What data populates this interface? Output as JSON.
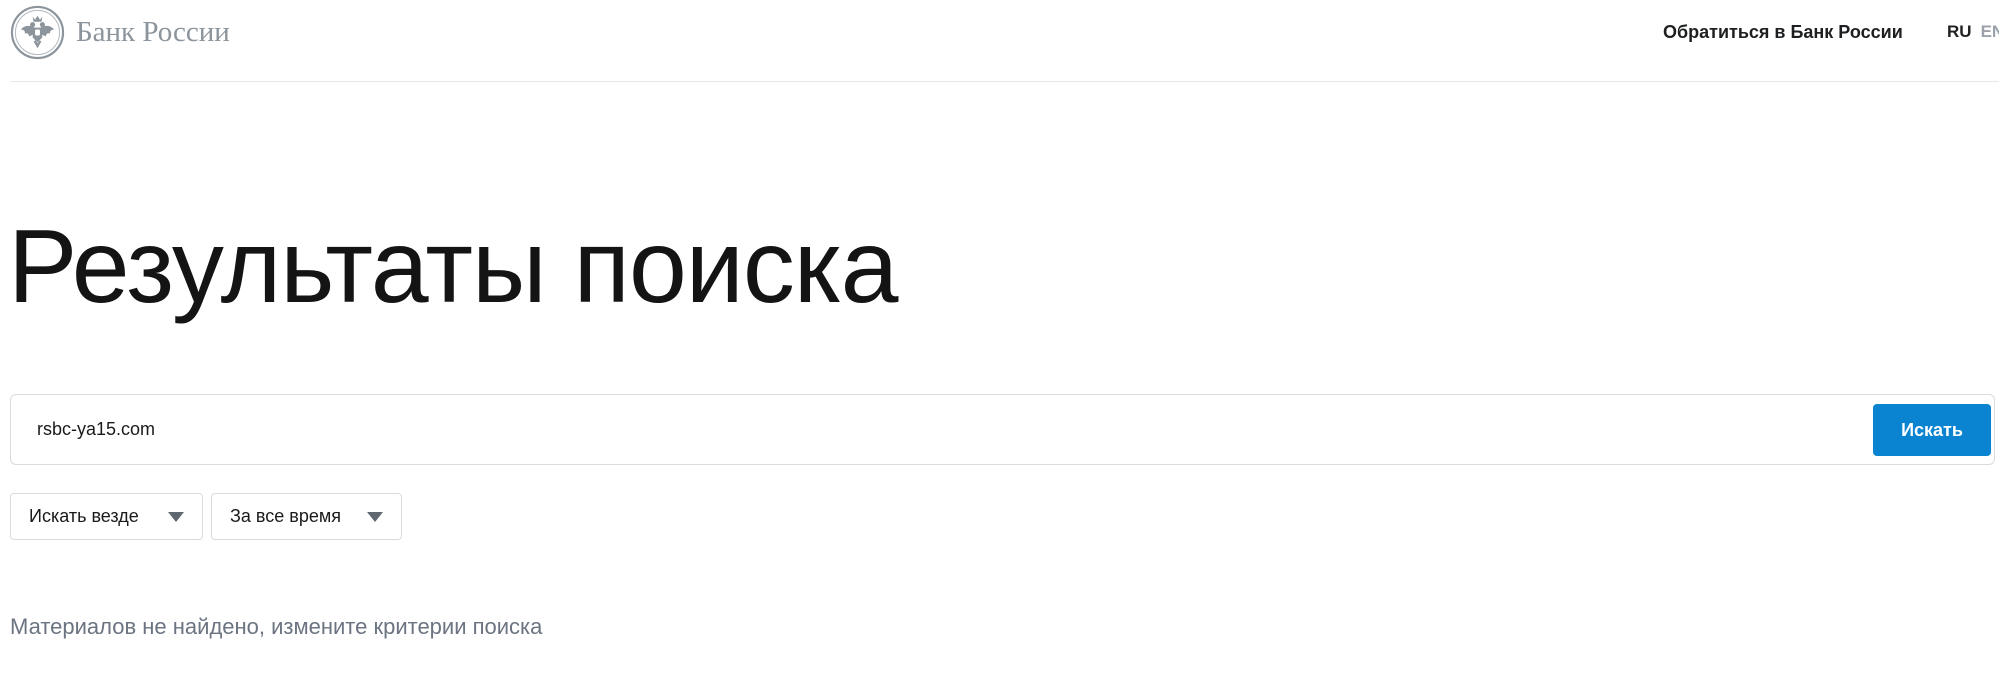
{
  "header": {
    "logo_text": "Банк России",
    "contact_link": "Обратиться в Банк России",
    "lang_ru": "RU",
    "lang_en": "EN"
  },
  "main": {
    "title": "Результаты поиска",
    "search": {
      "value": "rsbc-ya15.com",
      "button_label": "Искать"
    },
    "filters": {
      "where": "Искать везде",
      "when": "За все время"
    },
    "no_results_message": "Материалов не найдено, измените критерии поиска"
  },
  "colors": {
    "accent": "#0a84d0",
    "logo_gray": "#8c949c",
    "muted_text": "#6b7480"
  },
  "icons": {
    "logo": "double-headed-eagle-emblem",
    "dropdown": "triangle-down-icon"
  }
}
